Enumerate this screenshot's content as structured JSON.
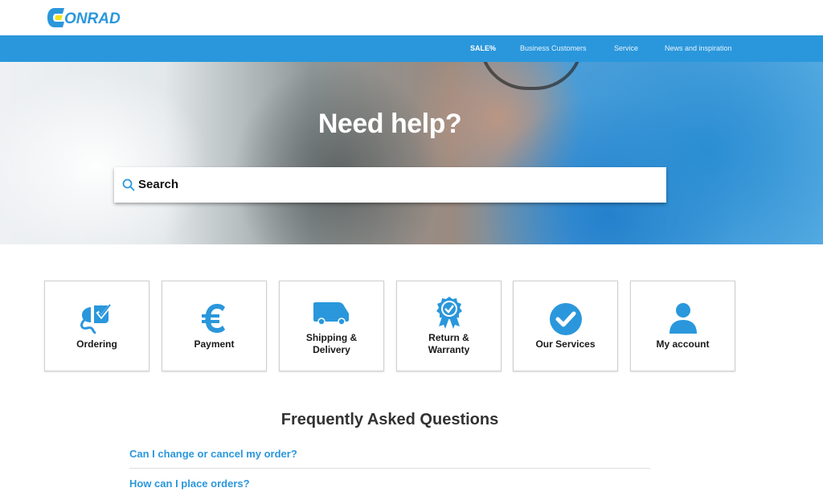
{
  "brand": {
    "logo_text": "ONRAD",
    "logo_icon": "conrad-c-logo",
    "accent": "#2a97dc",
    "logo_yellow": "#f2e21f"
  },
  "nav": {
    "items": [
      {
        "label": "SALE%"
      },
      {
        "label": "Business Customers"
      },
      {
        "label": "Service"
      },
      {
        "label": "News and inspiration"
      }
    ]
  },
  "hero": {
    "title": "Need help?",
    "search": {
      "placeholder": "Search",
      "icon": "search-icon"
    }
  },
  "tiles": [
    {
      "label_line1": "Ordering",
      "label_line2": "",
      "icon": "plug-check-icon"
    },
    {
      "label_line1": "Payment",
      "label_line2": "",
      "icon": "euro-icon"
    },
    {
      "label_line1": "Shipping &",
      "label_line2": "Delivery",
      "icon": "van-icon"
    },
    {
      "label_line1": "Return &",
      "label_line2": "Warranty",
      "icon": "award-badge-icon"
    },
    {
      "label_line1": "Our Services",
      "label_line2": "",
      "icon": "check-circle-icon"
    },
    {
      "label_line1": "My account",
      "label_line2": "",
      "icon": "user-icon"
    }
  ],
  "faq": {
    "title": "Frequently Asked Questions",
    "items": [
      {
        "question": "Can I change or cancel my order?"
      },
      {
        "question": "How can I place orders?"
      }
    ]
  }
}
